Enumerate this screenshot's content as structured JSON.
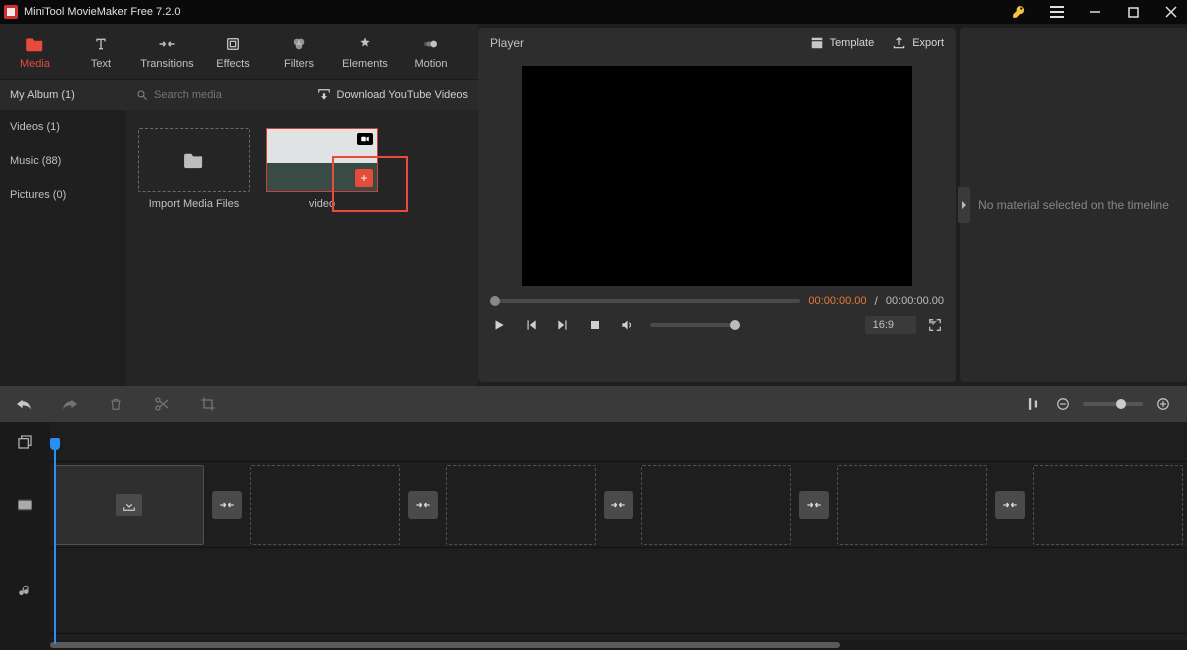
{
  "app": {
    "title": "MiniTool MovieMaker Free 7.2.0"
  },
  "nav": {
    "media": "Media",
    "text": "Text",
    "transitions": "Transitions",
    "effects": "Effects",
    "filters": "Filters",
    "elements": "Elements",
    "motion": "Motion"
  },
  "album": {
    "header": "My Album (1)",
    "videos": "Videos (1)",
    "music": "Music (88)",
    "pictures": "Pictures (0)"
  },
  "media": {
    "search_placeholder": "Search media",
    "download_yt": "Download YouTube Videos",
    "import_label": "Import Media Files",
    "clip1_label": "video"
  },
  "player": {
    "title": "Player",
    "template": "Template",
    "export": "Export",
    "time_current": "00:00:00.00",
    "time_sep": "/",
    "time_total": "00:00:00.00",
    "aspect": "16:9"
  },
  "right": {
    "empty_text": "No material selected on the timeline"
  }
}
